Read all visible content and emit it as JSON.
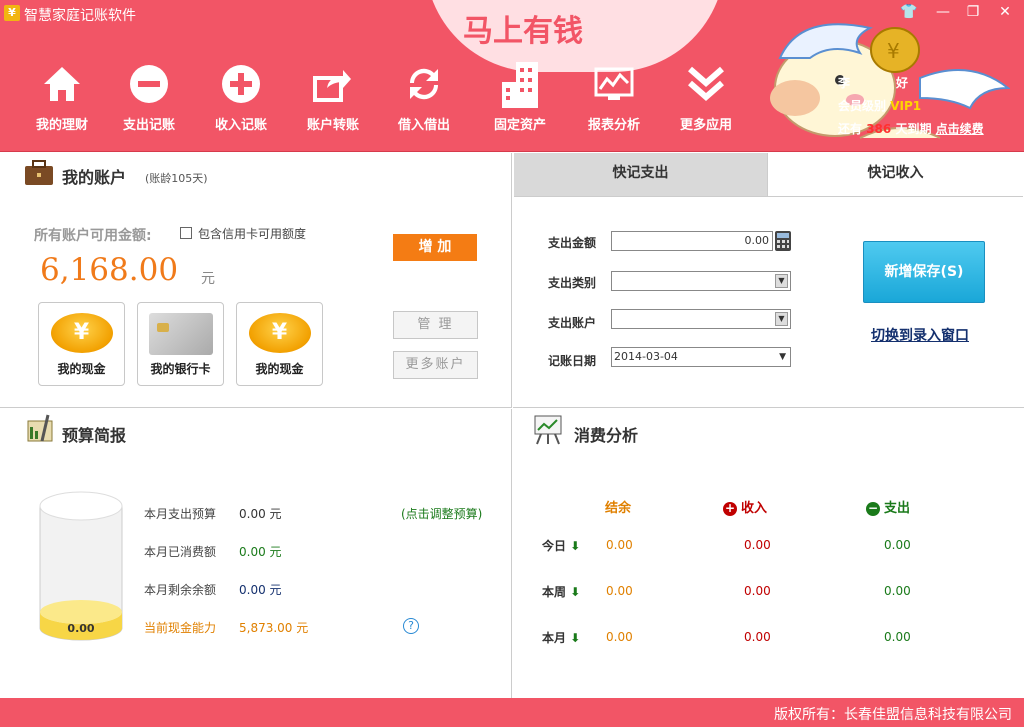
{
  "app": {
    "title": "智慧家庭记账软件",
    "slogan": "马上有钱",
    "logo_glyph": "¥"
  },
  "window_controls": [
    {
      "name": "skin-icon",
      "glyph": "👕"
    },
    {
      "name": "minimize-icon",
      "glyph": "—"
    },
    {
      "name": "maximize-icon",
      "glyph": "❐"
    },
    {
      "name": "close-icon",
      "glyph": "✕"
    }
  ],
  "nav": [
    {
      "label": "我的理财",
      "icon": "home-icon"
    },
    {
      "label": "支出记账",
      "icon": "minus-circle-icon"
    },
    {
      "label": "收入记账",
      "icon": "plus-circle-icon"
    },
    {
      "label": "账户转账",
      "icon": "transfer-icon"
    },
    {
      "label": "借入借出",
      "icon": "refresh-icon"
    },
    {
      "label": "固定资产",
      "icon": "building-icon"
    },
    {
      "label": "报表分析",
      "icon": "chart-icon"
    },
    {
      "label": "更多应用",
      "icon": "chevron-down-icon"
    }
  ],
  "user": {
    "greeting": "李",
    "greeting_suffix": "好",
    "vip_label": "会员级别",
    "vip": "VIP1",
    "days_prefix": "还有",
    "days": "386",
    "days_suffix": "天到期",
    "renew": "点击续费"
  },
  "account": {
    "title": "我的账户",
    "age": "(账龄105天)",
    "available_label": "所有账户可用金额:",
    "credit_checkbox": "包含信用卡可用额度",
    "amount": "6,168.00",
    "unit": "元",
    "add_button": "增 加",
    "manage_button": "管 理",
    "more_button": "更多账户",
    "cards": [
      {
        "label": "我的现金",
        "icon": "yuan-coin-icon"
      },
      {
        "label": "我的银行卡",
        "icon": "bank-card-icon"
      },
      {
        "label": "我的现金",
        "icon": "yuan-coin-icon"
      }
    ]
  },
  "quick": {
    "tabs": [
      "快记支出",
      "快记收入"
    ],
    "fields": [
      {
        "label": "支出金额",
        "value": "0.00"
      },
      {
        "label": "支出类别",
        "value": ""
      },
      {
        "label": "支出账户",
        "value": ""
      },
      {
        "label": "记账日期",
        "value": "2014-03-04"
      }
    ],
    "save_button": "新增保存(S)",
    "switch_link": "切换到录入窗口"
  },
  "budget": {
    "title": "预算简报",
    "cup_value": "0.00",
    "adjust_link": "(点击调整预算)",
    "rows": [
      {
        "label": "本月支出预算",
        "value": "0.00",
        "unit": "元"
      },
      {
        "label": "本月已消费额",
        "value": "0.00",
        "unit": "元"
      },
      {
        "label": "本月剩余余额",
        "value": "0.00",
        "unit": "元"
      },
      {
        "label": "当前现金能力",
        "value": "5,873.00",
        "unit": "元"
      }
    ],
    "help_glyph": "?"
  },
  "analysis": {
    "title": "消费分析",
    "headers": [
      "结余",
      "收入",
      "支出"
    ],
    "rows": [
      {
        "label": "今日",
        "balance": "0.00",
        "income": "0.00",
        "expense": "0.00"
      },
      {
        "label": "本周",
        "balance": "0.00",
        "income": "0.00",
        "expense": "0.00"
      },
      {
        "label": "本月",
        "balance": "0.00",
        "income": "0.00",
        "expense": "0.00"
      }
    ],
    "colors": {
      "balance": "#e08000",
      "income": "#c00000",
      "expense": "#1a7a1a"
    }
  },
  "footer": {
    "copyright": "版权所有：长春佳盟信息科技有限公司"
  }
}
